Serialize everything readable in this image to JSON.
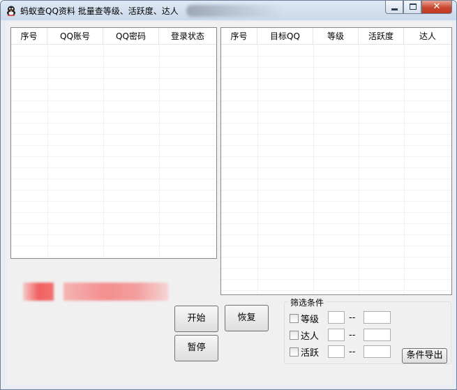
{
  "window": {
    "title": "蚂蚁查QQ资料 批量查等级、活跃度、达人 ",
    "controls": {
      "minimize": "",
      "maximize": "",
      "close": "✕"
    }
  },
  "accounts_list": {
    "columns": [
      "序号",
      "QQ账号",
      "QQ密码",
      "登录状态"
    ]
  },
  "results_list": {
    "columns": [
      "序号",
      "目标QQ",
      "等级",
      "活跃度",
      "达人"
    ]
  },
  "buttons": {
    "start": "开始",
    "pause": "暂停",
    "resume": "恢复",
    "export": "条件导出"
  },
  "filter": {
    "title": "筛选条件",
    "rows": [
      {
        "label": "等级",
        "checked": false,
        "from": "",
        "to": "",
        "separator": "--"
      },
      {
        "label": "达人",
        "checked": false,
        "from": "",
        "to": "",
        "separator": "--"
      },
      {
        "label": "活跃",
        "checked": false,
        "from": "",
        "to": "",
        "separator": "--"
      }
    ]
  },
  "colors": {
    "window_bg": "#f0f0f0",
    "title_gradient_top": "#dfe9f5",
    "close_red": "#c9472f"
  }
}
